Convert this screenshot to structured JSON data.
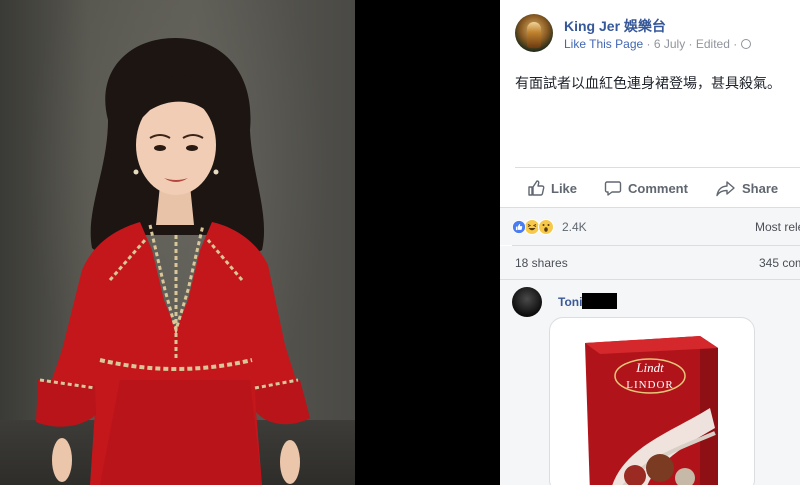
{
  "post": {
    "page_name": "King Jer 娛樂台",
    "like_page": "Like This Page",
    "separator": " · ",
    "date": "6 July",
    "edited": "Edited",
    "text": "有面試者以血紅色連身裙登場，甚具殺氣。"
  },
  "actions": {
    "like": "Like",
    "comment": "Comment",
    "share": "Share"
  },
  "stats": {
    "reaction_count": "2.4K",
    "reaction_icons": [
      "like-icon",
      "haha-icon",
      "wow-icon"
    ],
    "most_relevant": "Most rele",
    "shares": "18 shares",
    "comments": "345 com"
  },
  "comment": {
    "name": "Toni",
    "product_brand": "Lindt",
    "product_name": "LINDOR"
  },
  "colors": {
    "link_blue": "#365899",
    "dress_red": "#c4171c",
    "box_red": "#b0141a"
  }
}
